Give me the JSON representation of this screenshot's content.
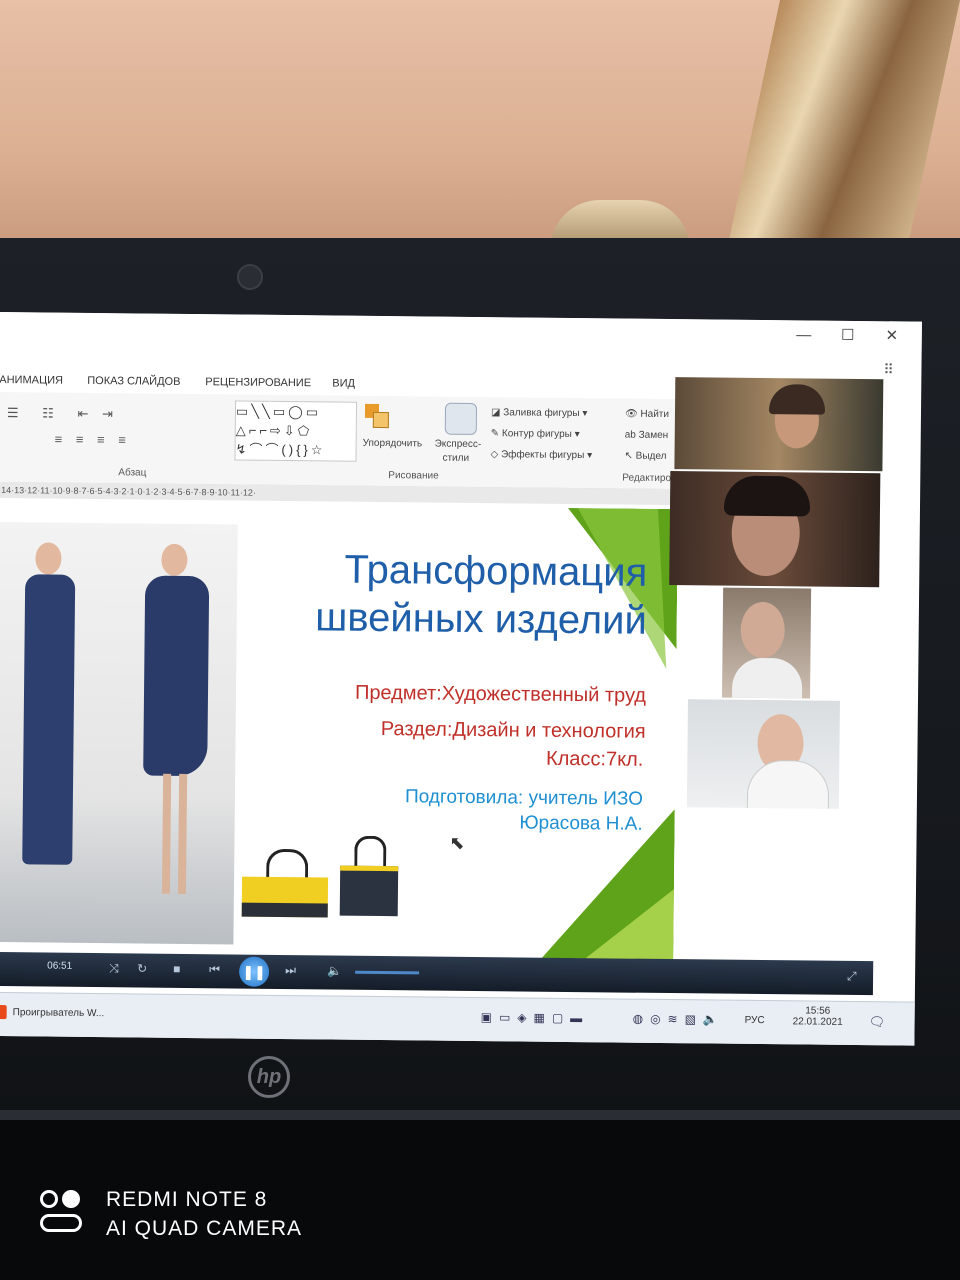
{
  "window": {
    "tabs": [
      "АНИМАЦИЯ",
      "ПОКАЗ СЛАЙДОВ",
      "РЕЦЕНЗИРОВАНИЕ",
      "ВИД"
    ],
    "minimize_icon": "minimize-icon",
    "maximize_icon": "maximize-icon",
    "close_icon": "close-icon"
  },
  "ribbon": {
    "paragraph_group": "Абзац",
    "drawing_group": "Рисование",
    "editing_group": "Редактиро",
    "arrange_label": "Упорядочить",
    "quick_styles_label": "Экспресс-",
    "quick_styles_label2": "стили",
    "shape_fill": "Заливка фигуры",
    "shape_outline": "Контур фигуры",
    "shape_effects": "Эффекты фигуры",
    "find": "Найти",
    "replace": "Замен",
    "select": "Выдел"
  },
  "ruler_text": "·14·13·12·11·10·9·8·7·6·5·4·3·2·1·0·1·2·3·4·5·6·7·8·9·10·11·12·",
  "slide": {
    "title_line1": "Трансформация",
    "title_line2": "швейных изделий",
    "subject": "Предмет:Художественный труд",
    "section": "Раздел:Дизайн и технология",
    "grade": "Класс:7кл.",
    "prepared_by": "Подготовила: учитель ИЗО",
    "author": "Юрасова Н.А."
  },
  "player": {
    "time": "06:51"
  },
  "taskbar": {
    "app_label": "Проигрыватель W...",
    "lang": "РУС",
    "clock_time": "15:56",
    "clock_date": "22.01.2021"
  },
  "laptop": {
    "brand": "hp"
  },
  "watermark": {
    "line1": "REDMI NOTE 8",
    "line2": "AI QUAD CAMERA"
  },
  "colors": {
    "slide_title": "#1f5ea8",
    "slide_red": "#c0302a",
    "slide_blue": "#1e8fd1",
    "slide_green": "#5fa31a"
  }
}
